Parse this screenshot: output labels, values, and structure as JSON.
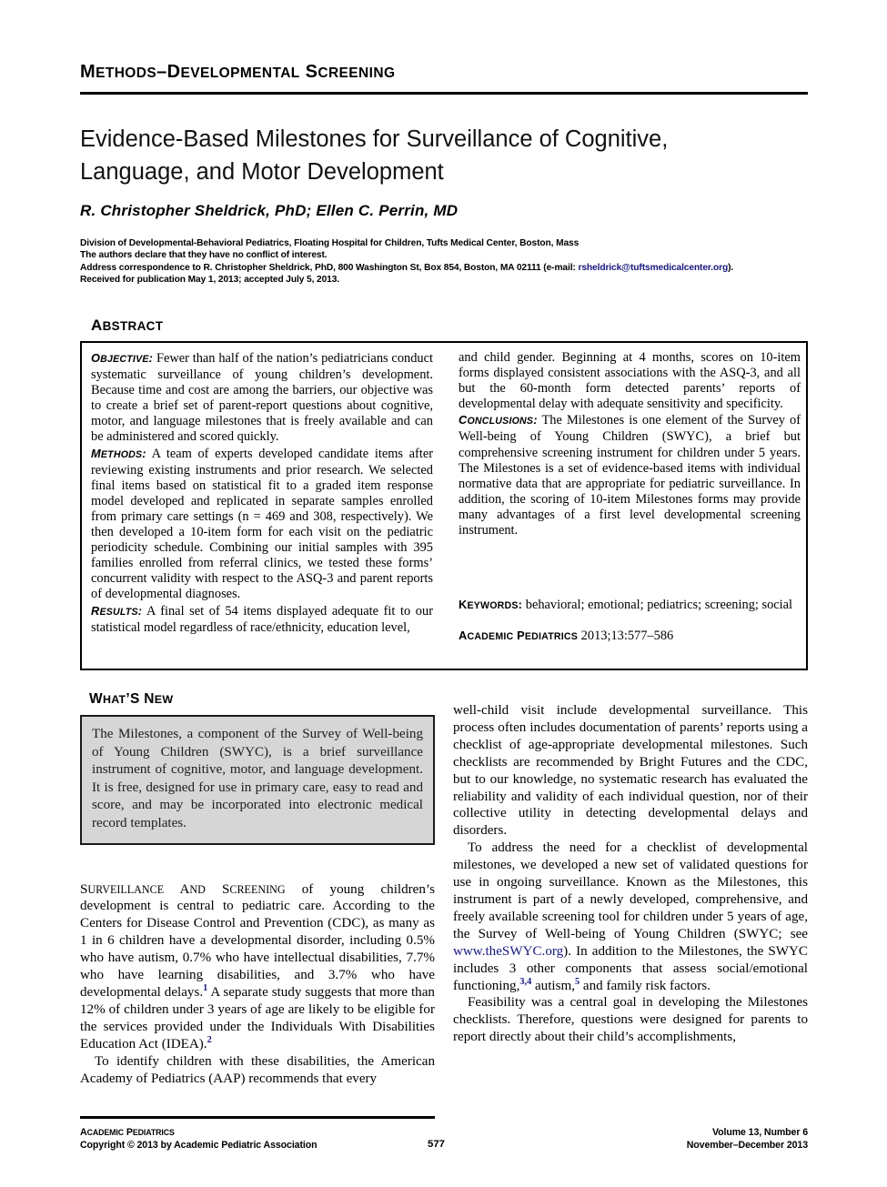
{
  "running_head": "METHODS–DEVELOPMENTAL SCREENING",
  "title_line1": "Evidence-Based Milestones for Surveillance of Cognitive,",
  "title_line2": "Language, and Motor Development",
  "authors": "R. Christopher Sheldrick, PhD; Ellen C. Perrin, MD",
  "affiliation": {
    "line1": "Division of Developmental-Behavioral Pediatrics, Floating Hospital for Children, Tufts Medical Center, Boston, Mass",
    "line2": "The authors declare that they have no conflict of interest.",
    "line3_pre": "Address correspondence to R. Christopher Sheldrick, PhD, 800 Washington St, Box 854, Boston, MA 02111 (e-mail: ",
    "email": "rsheldrick@tuftsmedicalcenter.org",
    "line3_post": ").",
    "line4": "Received for publication May 1, 2013; accepted July 5, 2013."
  },
  "abstract": {
    "heading": "ABSTRACT",
    "objective_label": "OBJECTIVE:",
    "objective_text": "Fewer than half of the nation’s pediatricians conduct systematic surveillance of young children’s development. Because time and cost are among the barriers, our objective was to create a brief set of parent-report questions about cognitive, motor, and language milestones that is freely available and can be administered and scored quickly.",
    "methods_label": "METHODS:",
    "methods_text": "A team of experts developed candidate items after reviewing existing instruments and prior research. We selected final items based on statistical fit to a graded item response model developed and replicated in separate samples enrolled from primary care settings (n = 469 and 308, respectively). We then developed a 10-item form for each visit on the pediatric periodicity schedule. Combining our initial samples with 395 families enrolled from referral clinics, we tested these forms’ concurrent validity with respect to the ASQ-3 and parent reports of developmental diagnoses.",
    "results_label": "RESULTS:",
    "results_text": "A final set of 54 items displayed adequate fit to our statistical model regardless of race/ethnicity, education level, and child gender. Beginning at 4 months, scores on 10-item forms displayed consistent associations with the ASQ-3, and all but the 60-month form detected parents’ reports of developmental delay with adequate sensitivity and specificity.",
    "conclusions_label": "CONCLUSIONS:",
    "conclusions_text": "The Milestones is one element of the Survey of Well-being of Young Children (SWYC), a brief but comprehensive screening instrument for children under 5 years. The Milestones is a set of evidence-based items with individual normative data that are appropriate for pediatric surveillance. In addition, the scoring of 10-item Milestones forms may provide many advantages of a first level developmental screening instrument.",
    "keywords_label": "KEYWORDS:",
    "keywords_text": "behavioral; emotional; pediatrics; screening; social",
    "journal_label": "ACADEMIC PEDIATRICS",
    "journal_citation": "2013;13:577–586"
  },
  "whats_new": {
    "heading": "WHAT’S NEW",
    "text": "The Milestones, a component of the Survey of Well-being of Young Children (SWYC), is a brief surveillance instrument of cognitive, motor, and language development. It is free, designed for use in primary care, easy to read and score, and may be incorporated into electronic medical record templates."
  },
  "body": {
    "left_p1_lead": "SURVEILLANCE AND SCREENING",
    "left_p1": " of young children’s development is central to pediatric care. According to the Centers for Disease Control and Prevention (CDC), as many as 1 in 6 children have a developmental disorder, including 0.5% who have autism, 0.7% who have intellectual disabilities, 7.7% who have learning disabilities, and 3.7% who have developmental delays.",
    "left_p1_ref1": "1",
    "left_p1_cont": " A separate study suggests that more than 12% of children under 3 years of age are likely to be eligible for the services provided under the Individuals With Disabilities Education Act (IDEA).",
    "left_p1_ref2": "2",
    "left_p2": "To identify children with these disabilities, the American Academy of Pediatrics (AAP) recommends that every",
    "right_p1": "well-child visit include developmental surveillance. This process often includes documentation of parents’ reports using a checklist of age-appropriate developmental milestones. Such checklists are recommended by Bright Futures and the CDC, but to our knowledge, no systematic research has evaluated the reliability and validity of each individual question, nor of their collective utility in detecting developmental delays and disorders.",
    "right_p2a": "To address the need for a checklist of developmental milestones, we developed a new set of validated questions for use in ongoing surveillance. Known as the Milestones, this instrument is part of a newly developed, comprehensive, and freely available screening tool for children under 5 years of age, the Survey of Well-being of Young Children (SWYC; see ",
    "right_p2_link": "www.theSWYC.org",
    "right_p2b": "). In addition to the Milestones, the SWYC includes 3 other components that assess social/emotional functioning,",
    "right_p2_ref34": "3,4",
    "right_p2c": " autism,",
    "right_p2_ref5": "5",
    "right_p2d": " and family risk factors.",
    "right_p3": "Feasibility was a central goal in developing the Milestones checklists. Therefore, questions were designed for parents to report directly about their child’s accomplishments,"
  },
  "footer": {
    "journal": "ACADEMIC PEDIATRICS",
    "copyright": "Copyright © 2013 by Academic Pediatric Association",
    "page_number": "577",
    "volume": "Volume 13, Number 6",
    "issue_date": "November–December 2013"
  },
  "colors": {
    "link": "#16167e",
    "whatsnew_bg": "#d6d6d6",
    "rule": "#000000"
  }
}
